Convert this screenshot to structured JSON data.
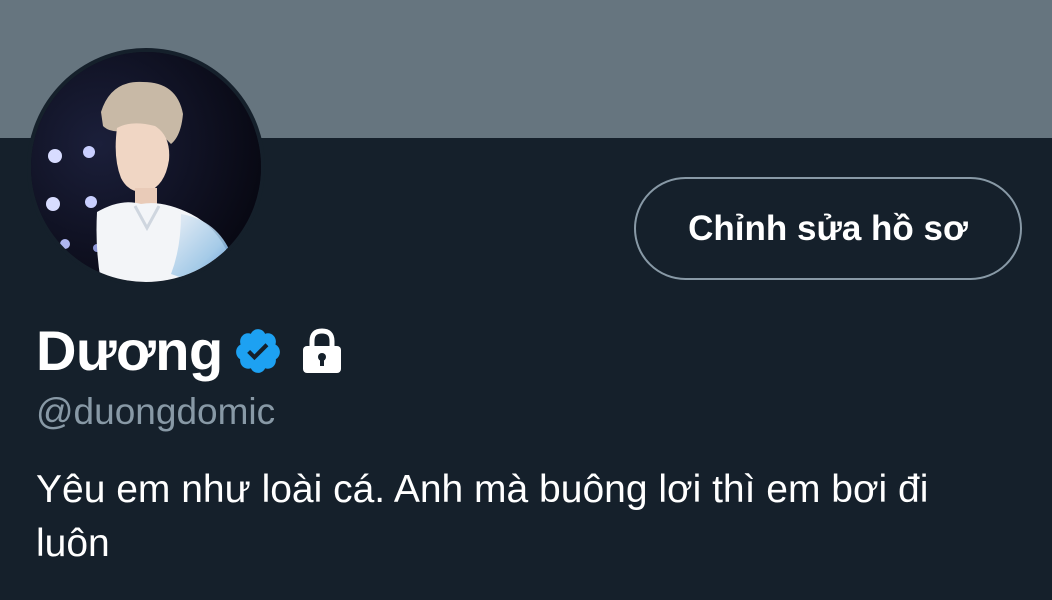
{
  "profile": {
    "display_name": "Dương",
    "handle": "@duongdomic",
    "bio": "Yêu em như loài cá. Anh mà buông lơi thì em bơi đi luôn",
    "verified": true,
    "protected": true,
    "avatar_alt": "profile-photo"
  },
  "actions": {
    "edit_profile_label": "Chỉnh sửa hồ sơ"
  },
  "colors": {
    "background": "#15202b",
    "banner": "#66757f",
    "verified_badge": "#1da1f2",
    "secondary_text": "#8899a6",
    "button_border": "#8899a6"
  },
  "icons": {
    "verified": "verified-badge-icon",
    "protected": "lock-icon"
  }
}
